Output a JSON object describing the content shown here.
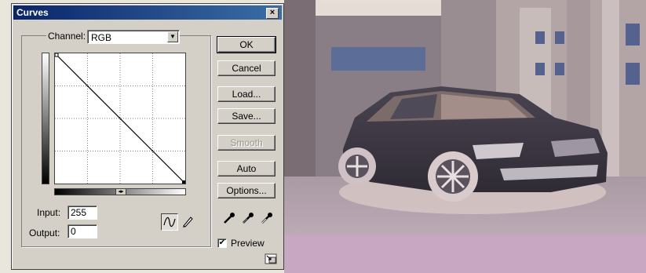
{
  "dialog": {
    "title": "Curves",
    "close_glyph": "×",
    "channel_label": "Channel:",
    "channel_value": "RGB",
    "input_label": "Input:",
    "input_value": "255",
    "output_label": "Output:",
    "output_value": "0",
    "buttons": {
      "ok": "OK",
      "cancel": "Cancel",
      "load": "Load...",
      "save": "Save...",
      "smooth": "Smooth",
      "auto": "Auto",
      "options": "Options..."
    },
    "preview_label": "Preview",
    "preview_checked": true,
    "icons": [
      "curve-tool-icon",
      "pencil-tool-icon",
      "black-eyedropper-icon",
      "gray-eyedropper-icon",
      "white-eyedropper-icon",
      "expand-dialog-icon"
    ]
  },
  "colors": {
    "dialog_bg": "#d4d0c8",
    "titlebar_start": "#0a246a",
    "titlebar_end": "#3a6ea5",
    "photo_sky": "#e6ddd6",
    "photo_building": "#8a7e86",
    "photo_car": "#3f3a44",
    "photo_ground": "#b9a6b0"
  }
}
